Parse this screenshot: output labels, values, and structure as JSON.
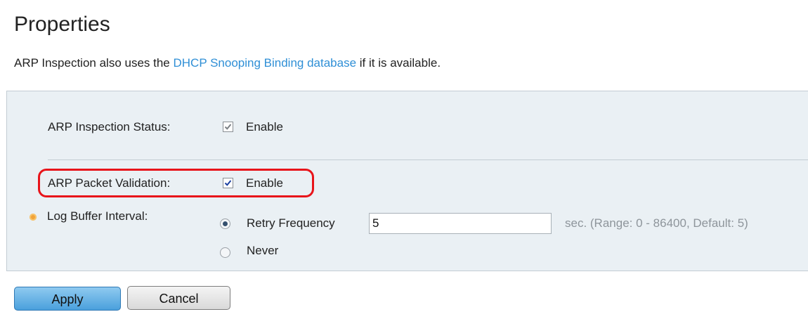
{
  "page": {
    "title": "Properties",
    "intro_before": "ARP Inspection also uses the ",
    "intro_link": "DHCP Snooping Binding database",
    "intro_after": " if it is available."
  },
  "form": {
    "arp_inspection_status": {
      "label": "ARP Inspection Status:",
      "checked": true,
      "option_label": "Enable"
    },
    "arp_packet_validation": {
      "label": "ARP Packet Validation:",
      "checked": true,
      "option_label": "Enable"
    },
    "log_buffer_interval": {
      "label": "Log Buffer Interval:",
      "selected_option": "Retry Frequency",
      "retry_frequency_label": "Retry Frequency",
      "retry_frequency_value": "5",
      "hint": "sec. (Range: 0 - 86400, Default: 5)",
      "never_label": "Never"
    }
  },
  "actions": {
    "apply_label": "Apply",
    "cancel_label": "Cancel"
  },
  "colors": {
    "link": "#2f8fd6",
    "panel_background": "#eaf0f4",
    "highlight_outline": "#e8141a",
    "required_icon": "#f1a33a",
    "apply_button": "#4aa0dc"
  },
  "icons": {
    "required": "required-field-icon"
  }
}
